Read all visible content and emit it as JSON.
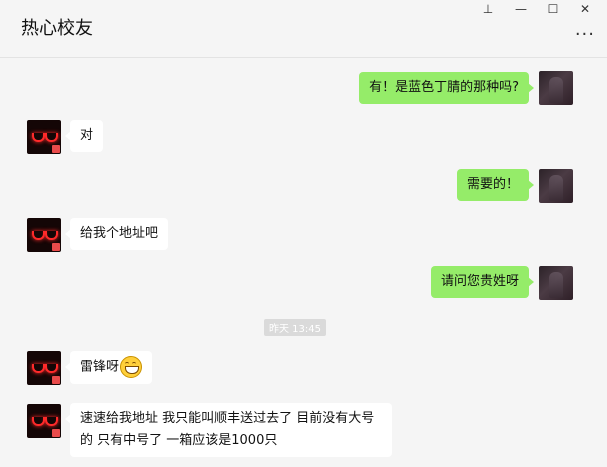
{
  "window": {
    "title": "热心校友",
    "pin_icon": "pin-icon",
    "minimize_icon": "minimize-icon",
    "maximize_icon": "maximize-icon",
    "close_icon": "close-icon",
    "more_icon": "more-icon"
  },
  "messages": [
    {
      "from": "me",
      "text": "有！是蓝色丁腈的那种吗?"
    },
    {
      "from": "other",
      "text": "对"
    },
    {
      "from": "me",
      "text": "需要的！"
    },
    {
      "from": "other",
      "text": "给我个地址吧"
    },
    {
      "from": "me",
      "text": "请问您贵姓呀"
    },
    {
      "from": "other",
      "text": "雷锋呀",
      "emoji": "grin-emoji"
    },
    {
      "from": "other",
      "text": "速速给我地址 我只能叫顺丰送过去了 目前没有大号的 只有中号了 一箱应该是1000只"
    }
  ],
  "timestamp": "昨天 13:45",
  "colors": {
    "my_bubble": "#95ec69",
    "other_bubble": "#ffffff",
    "background": "#f5f5f5"
  }
}
